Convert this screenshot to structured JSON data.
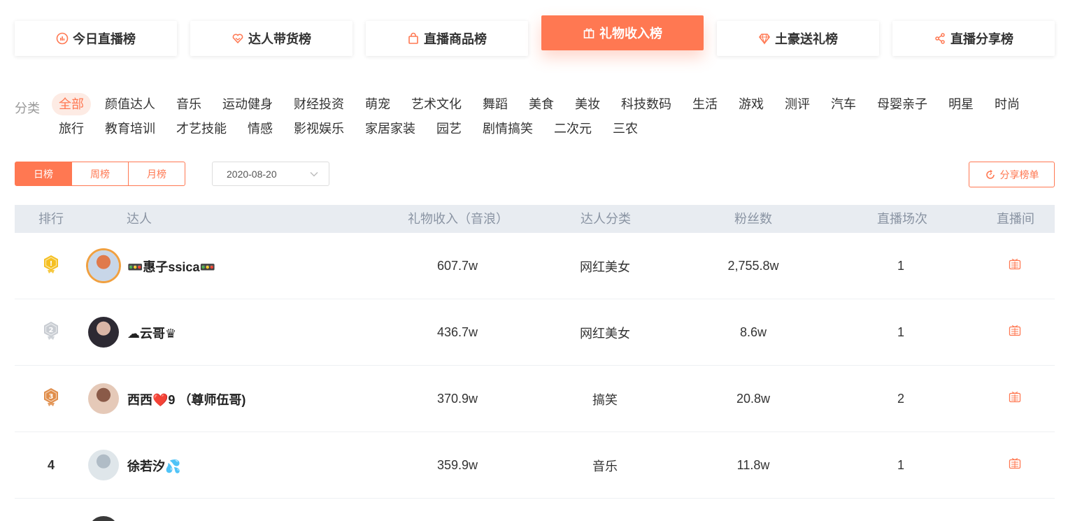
{
  "tabs": [
    {
      "label": "今日直播榜",
      "icon": "chart-circle-icon",
      "active": false
    },
    {
      "label": "达人带货榜",
      "icon": "heart-badge-icon",
      "active": false
    },
    {
      "label": "直播商品榜",
      "icon": "shopping-bag-icon",
      "active": false
    },
    {
      "label": "礼物收入榜",
      "icon": "gift-icon",
      "active": true
    },
    {
      "label": "土豪送礼榜",
      "icon": "diamond-icon",
      "active": false
    },
    {
      "label": "直播分享榜",
      "icon": "share-icon",
      "active": false
    }
  ],
  "categories": {
    "label": "分类",
    "row1": [
      "全部",
      "颜值达人",
      "音乐",
      "运动健身",
      "财经投资",
      "萌宠",
      "艺术文化",
      "舞蹈",
      "美食",
      "美妆",
      "科技数码",
      "生活",
      "游戏",
      "测评",
      "汽车",
      "母婴亲子",
      "明星",
      "时尚"
    ],
    "row2": [
      "旅行",
      "教育培训",
      "才艺技能",
      "情感",
      "影视娱乐",
      "家居家装",
      "园艺",
      "剧情搞笑",
      "二次元",
      "三农"
    ],
    "selected": "全部"
  },
  "period": {
    "options": [
      "日榜",
      "周榜",
      "月榜"
    ],
    "selected": "日榜"
  },
  "date": {
    "value": "2020-08-20"
  },
  "share_button": {
    "label": "分享榜单"
  },
  "table": {
    "headers": {
      "rank": "排行",
      "influencer": "达人",
      "income": "礼物收入（音浪）",
      "category": "达人分类",
      "fans": "粉丝数",
      "sessions": "直播场次",
      "room": "直播间"
    },
    "rows": [
      {
        "rank": "1",
        "medal": "gold",
        "name": "🚥惠子ssica🚥",
        "income": "607.7w",
        "category": "网红美女",
        "fans": "2,755.8w",
        "sessions": "1"
      },
      {
        "rank": "2",
        "medal": "silver",
        "name": "☁云哥♛",
        "income": "436.7w",
        "category": "网红美女",
        "fans": "8.6w",
        "sessions": "1"
      },
      {
        "rank": "3",
        "medal": "bronze",
        "name": "西西❤️9  （尊师伍哥)",
        "income": "370.9w",
        "category": "搞笑",
        "fans": "20.8w",
        "sessions": "2"
      },
      {
        "rank": "4",
        "medal": "none",
        "name": "徐若汐💦",
        "income": "359.9w",
        "category": "音乐",
        "fans": "11.8w",
        "sessions": "1"
      }
    ],
    "live_icon": "live-room-icon"
  },
  "colors": {
    "accent": "#ff7852",
    "header_bg": "#e8ecf1",
    "gold": "#f5c023",
    "silver": "#c8ccd2",
    "bronze": "#e08d4a"
  }
}
